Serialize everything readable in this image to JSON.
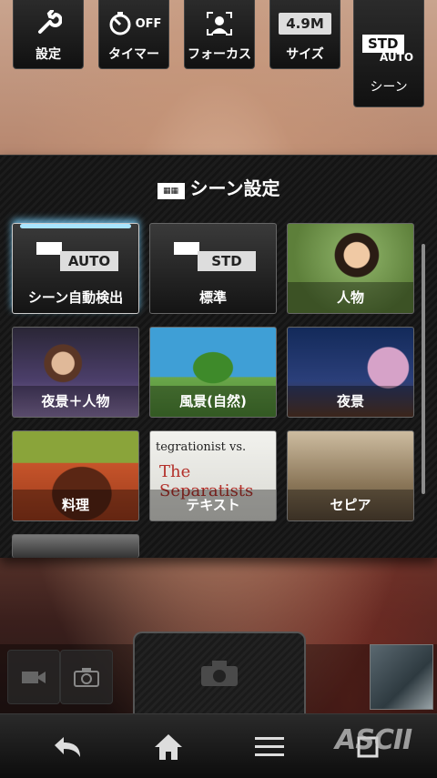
{
  "toolbar": {
    "settings": {
      "label": "設定",
      "icon": "wrench-icon"
    },
    "timer": {
      "label": "タイマー",
      "icon": "timer-icon",
      "state": "OFF"
    },
    "focus": {
      "label": "フォーカス",
      "icon": "face-focus-icon"
    },
    "size": {
      "label": "サイズ",
      "value": "4.9M"
    },
    "scene": {
      "label": "シーン",
      "badge_top": "STD",
      "badge_bottom": "AUTO"
    }
  },
  "scene_panel": {
    "title": "シーン設定",
    "tiles": [
      {
        "label": "シーン自動検出",
        "badge": "AUTO",
        "selected": true
      },
      {
        "label": "標準",
        "badge": "STD",
        "selected": false
      },
      {
        "label": "人物",
        "selected": false
      },
      {
        "label": "夜景＋人物",
        "selected": false
      },
      {
        "label": "風景(自然)",
        "selected": false
      },
      {
        "label": "夜景",
        "selected": false
      },
      {
        "label": "料理",
        "selected": false
      },
      {
        "label": "テキスト",
        "selected": false,
        "photo_text_1": "tegrationist vs.",
        "photo_text_2": "The Separatists"
      },
      {
        "label": "セピア",
        "selected": false
      }
    ]
  },
  "capture": {
    "video_mode_icon": "video-camera-icon",
    "photo_mode_icon": "camera-icon",
    "shutter_icon": "camera-icon"
  },
  "navbar": {
    "icons": [
      "back-icon",
      "home-icon",
      "menu-icon",
      "recent-apps-icon"
    ]
  },
  "watermark": "ASCII"
}
